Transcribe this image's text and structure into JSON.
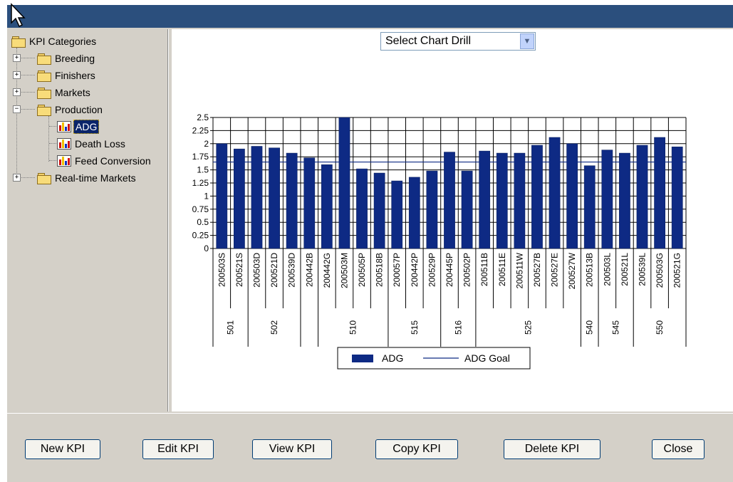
{
  "tree": {
    "root_label": "KPI Categories",
    "items": [
      {
        "label": "Breeding"
      },
      {
        "label": "Finishers"
      },
      {
        "label": "Markets"
      },
      {
        "label": "Production"
      },
      {
        "label": "ADG"
      },
      {
        "label": "Death Loss"
      },
      {
        "label": "Feed Conversion"
      },
      {
        "label": "Real-time Markets"
      }
    ]
  },
  "drill_select": {
    "value": "Select Chart Drill"
  },
  "buttons": {
    "new": "New KPI",
    "edit": "Edit KPI",
    "view": "View KPI",
    "copy": "Copy KPI",
    "delete": "Delete KPI",
    "close": "Close"
  },
  "colors": {
    "bar": "#0e2a84",
    "goal": "#0e2a84",
    "titlebar": "#2b4f7d",
    "selection": "#0a246a"
  },
  "icons": [
    "pointer-cursor-icon",
    "folder-icon",
    "chart-icon",
    "expand-plus-icon",
    "collapse-minus-icon",
    "dropdown-arrow-icon"
  ],
  "chart_data": {
    "type": "bar",
    "categories": [
      "200503S",
      "200521S",
      "200503D",
      "200521D",
      "200539D",
      "200442B",
      "200442G",
      "200503M",
      "200505P",
      "200518B",
      "200057P",
      "200442P",
      "200529P",
      "200445P",
      "200502P",
      "200511B",
      "200511E",
      "200511W",
      "200527B",
      "200527E",
      "200527W",
      "200513B",
      "200503L",
      "200521L",
      "200539L",
      "200503G",
      "200521G"
    ],
    "groups": [
      {
        "label": "501",
        "span": 2
      },
      {
        "label": "502",
        "span": 3
      },
      {
        "label": "",
        "span": 1
      },
      {
        "label": "510",
        "span": 4
      },
      {
        "label": "515",
        "span": 3
      },
      {
        "label": "516",
        "span": 2
      },
      {
        "label": "525",
        "span": 6
      },
      {
        "label": "540",
        "span": 1
      },
      {
        "label": "545",
        "span": 2
      },
      {
        "label": "550",
        "span": 3
      }
    ],
    "series": [
      {
        "name": "ADG",
        "values": [
          2.0,
          1.9,
          1.95,
          1.92,
          1.82,
          1.73,
          1.6,
          2.5,
          1.52,
          1.44,
          1.29,
          1.36,
          1.48,
          1.84,
          1.48,
          1.86,
          1.82,
          1.82,
          1.97,
          2.12,
          2.0,
          1.58,
          1.88,
          1.82,
          1.97,
          2.12,
          1.94
        ]
      },
      {
        "name": "ADG Goal",
        "values": [
          1.65,
          1.65,
          1.65,
          1.65,
          1.65,
          1.65,
          1.65,
          1.65,
          1.65,
          1.65,
          1.65,
          1.65,
          1.65,
          1.65,
          1.65,
          1.65,
          1.65,
          1.65,
          1.65,
          1.65,
          1.65,
          1.65,
          1.65,
          1.65,
          1.65,
          1.65,
          1.65
        ]
      }
    ],
    "yticks": [
      "0",
      "0.25",
      "0.5",
      "0.75",
      "1",
      "1.25",
      "1.5",
      "1.75",
      "2",
      "2.25",
      "2.5"
    ],
    "ylim": [
      0,
      2.5
    ],
    "grid": true,
    "legend": "bottom"
  }
}
